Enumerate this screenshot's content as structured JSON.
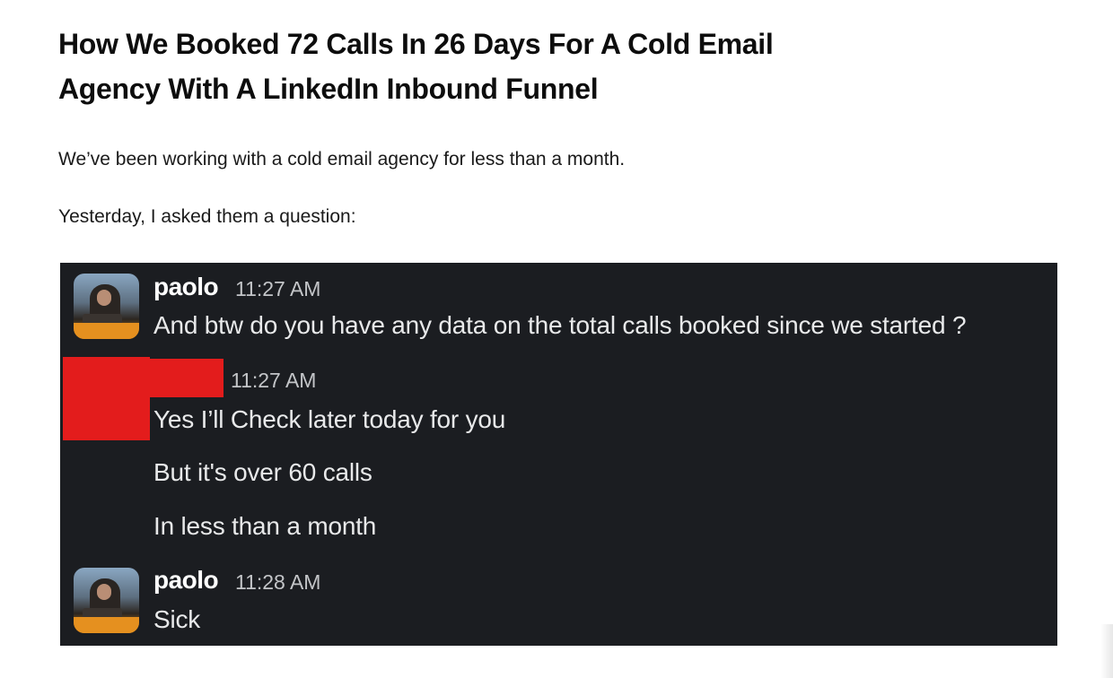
{
  "article": {
    "title_line_1": "How We Booked 72 Calls In 26 Days For A Cold Email",
    "title_line_2": "Agency With A LinkedIn Inbound Funnel",
    "paragraph_1": "We’ve been working with a cold email agency for less than a month.",
    "paragraph_2": "Yesterday, I asked them a question:"
  },
  "chat": {
    "background_color": "#1b1d21",
    "redaction_color": "#e31c1c",
    "messages": [
      {
        "username": "paolo",
        "time": "11:27 AM",
        "lines": [
          "And btw do you have any data on the total calls booked since we started ?"
        ]
      },
      {
        "username": "",
        "time": "11:27 AM",
        "lines": [
          "Yes I’ll Check later today for you",
          "But it's over 60 calls",
          "In less than a month"
        ]
      },
      {
        "username": "paolo",
        "time": "11:28 AM",
        "lines": [
          "Sick"
        ]
      }
    ]
  }
}
